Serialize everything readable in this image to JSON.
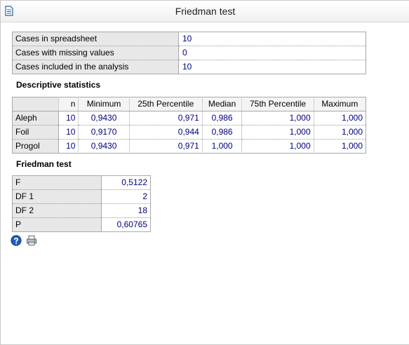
{
  "window": {
    "title": "Friedman test"
  },
  "summary": [
    {
      "label": "Cases in spreadsheet",
      "value": "10"
    },
    {
      "label": "Cases with missing values",
      "value": "0"
    },
    {
      "label": "Cases included in the analysis",
      "value": "10"
    }
  ],
  "descriptive": {
    "heading": "Descriptive statistics",
    "columns": [
      "",
      "n",
      "Minimum",
      "25th Percentile",
      "Median",
      "75th Percentile",
      "Maximum"
    ],
    "rows": [
      {
        "name": "Aleph",
        "n": "10",
        "min": "0,9430",
        "p25": "0,971",
        "median": "0,986",
        "p75": "1,000",
        "max": "1,000"
      },
      {
        "name": "Foil",
        "n": "10",
        "min": "0,9170",
        "p25": "0,944",
        "median": "0,986",
        "p75": "1,000",
        "max": "1,000"
      },
      {
        "name": "Progol",
        "n": "10",
        "min": "0,9430",
        "p25": "0,971",
        "median": "1,000",
        "p75": "1,000",
        "max": "1,000"
      }
    ]
  },
  "friedman": {
    "heading": "Friedman test",
    "rows": [
      {
        "label": "F",
        "value": "0,5122"
      },
      {
        "label": "DF 1",
        "value": "2"
      },
      {
        "label": "DF 2",
        "value": "18"
      },
      {
        "label": "P",
        "value": "0,60765"
      }
    ]
  },
  "icons": [
    "help-icon",
    "print-icon"
  ],
  "colors": {
    "value_text": "#000080",
    "label_bg": "#e8e8e8",
    "border": "#a9a9a9"
  }
}
